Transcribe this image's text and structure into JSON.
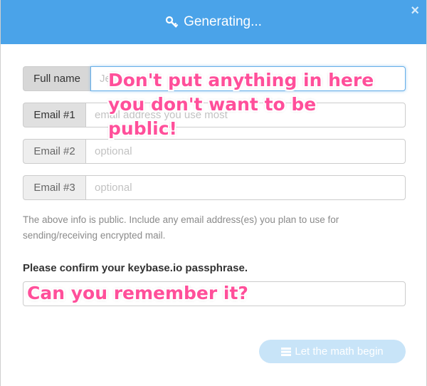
{
  "modal": {
    "title": "Generating...",
    "close_symbol": "×"
  },
  "form": {
    "fields": [
      {
        "label": "Full name",
        "placeholder": "Je",
        "focused": true
      },
      {
        "label": "Email #1",
        "placeholder": "email address you use most"
      },
      {
        "label": "Email #2",
        "placeholder": "optional"
      },
      {
        "label": "Email #3",
        "placeholder": "optional"
      }
    ],
    "help_text": "The above info is public. Include any email address(es) you plan to use for sending/receiving encrypted mail.",
    "confirm_label": "Please confirm your keybase.io passphrase.",
    "submit_label": "Let the math begin"
  },
  "annotations": {
    "public_warning": "Don't put anything in here\nyou don't want to be\npublic!",
    "remember": "Can you remember it?"
  },
  "colors": {
    "header": "#4aa3e9",
    "annotation": "#ff4f9a",
    "button": "#c8e4f8"
  }
}
